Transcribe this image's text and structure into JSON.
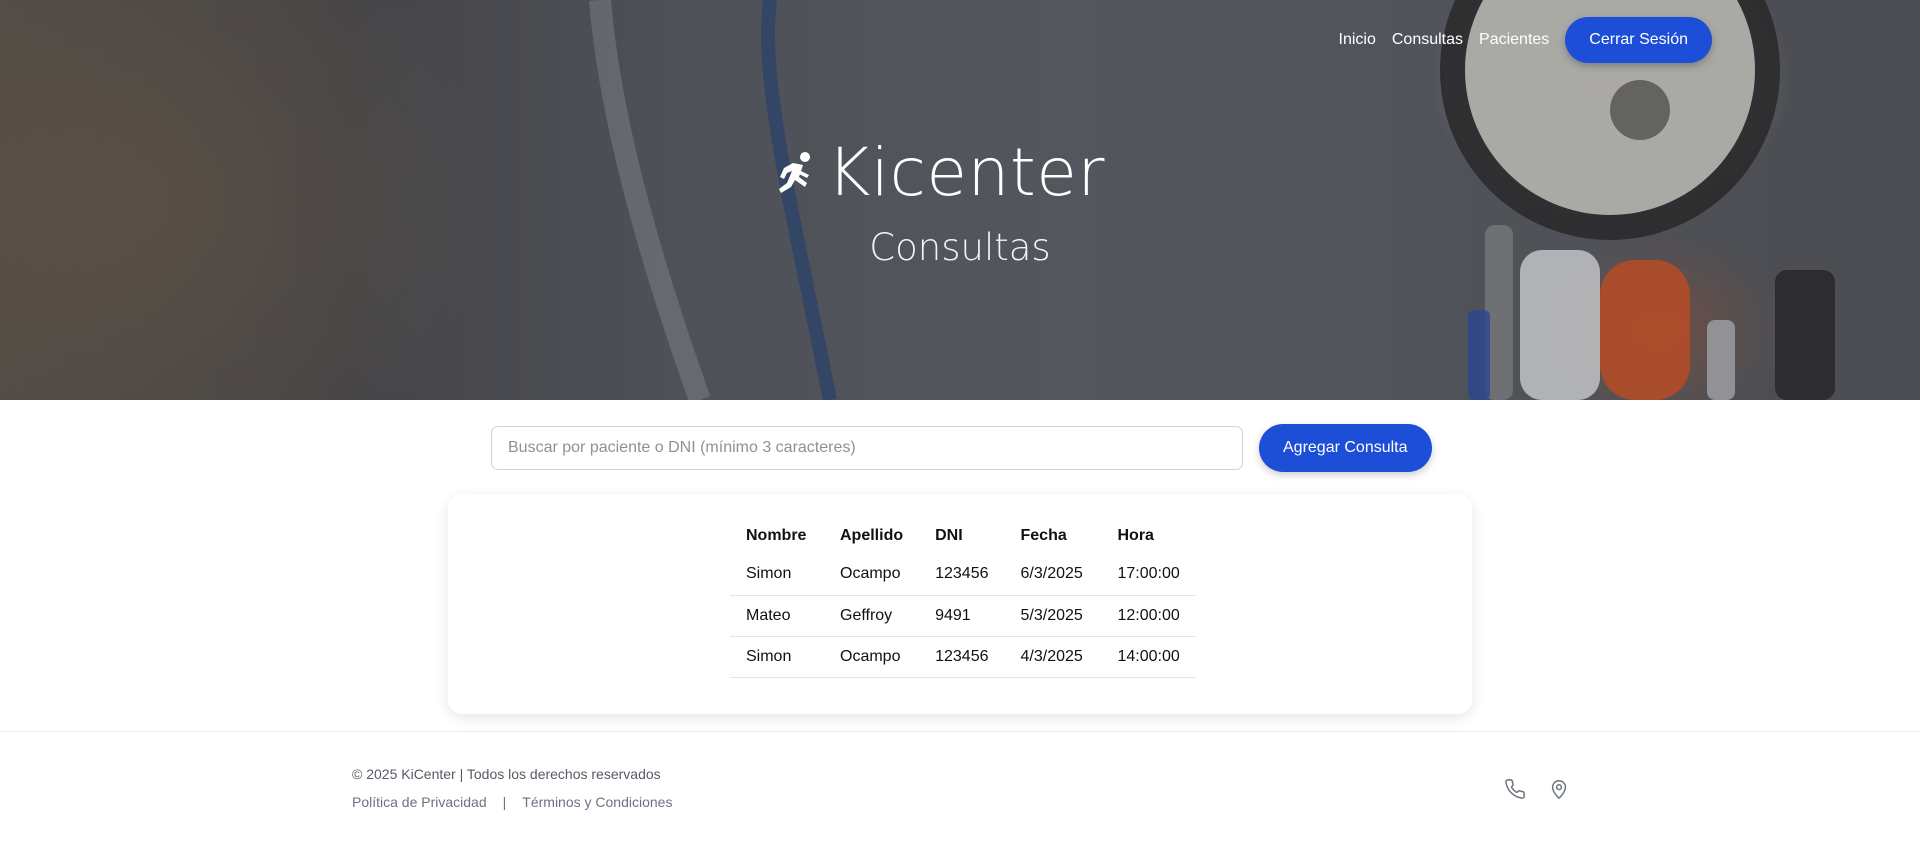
{
  "nav": {
    "links": [
      "Inicio",
      "Consultas",
      "Pacientes"
    ],
    "logout_label": "Cerrar Sesión"
  },
  "hero": {
    "brand_name": "Kicenter",
    "brand_icon": "runner-icon",
    "subtitle": "Consultas"
  },
  "search": {
    "placeholder": "Buscar por paciente o DNI (mínimo 3 caracteres)",
    "value": ""
  },
  "add_button_label": "Agregar Consulta",
  "table": {
    "headers": [
      "Nombre",
      "Apellido",
      "DNI",
      "Fecha",
      "Hora"
    ],
    "rows": [
      [
        "Simon",
        "Ocampo",
        "123456",
        "6/3/2025",
        "17:00:00"
      ],
      [
        "Mateo",
        "Geffroy",
        "9491",
        "5/3/2025",
        "12:00:00"
      ],
      [
        "Simon",
        "Ocampo",
        "123456",
        "4/3/2025",
        "14:00:00"
      ]
    ]
  },
  "footer": {
    "copyright": "© 2025 KiCenter | Todos los derechos reservados",
    "privacy_label": "Política de Privacidad",
    "separator": "|",
    "terms_label": "Términos y Condiciones",
    "icons": [
      "phone-icon",
      "map-pin-icon"
    ]
  },
  "colors": {
    "primary": "#1d4ed8",
    "footer_text": "#6b7280"
  }
}
